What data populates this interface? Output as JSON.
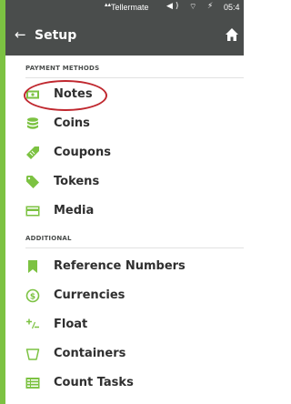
{
  "status_bar": {
    "carrier": "Tellermate",
    "time": "05:4"
  },
  "toolbar": {
    "title": "Setup"
  },
  "sections": {
    "payment_methods": "PAYMENT METHODS",
    "additional": "ADDITIONAL"
  },
  "payment_items": [
    {
      "label": "Notes",
      "icon": "banknote-icon"
    },
    {
      "label": "Coins",
      "icon": "coin-stack-icon"
    },
    {
      "label": "Coupons",
      "icon": "coupon-icon"
    },
    {
      "label": "Tokens",
      "icon": "tag-icon"
    },
    {
      "label": "Media",
      "icon": "card-icon"
    }
  ],
  "additional_items": [
    {
      "label": "Reference Numbers",
      "icon": "bookmark-icon"
    },
    {
      "label": "Currencies",
      "icon": "dollar-circle-icon"
    },
    {
      "label": "Float",
      "icon": "plus-minus-icon"
    },
    {
      "label": "Containers",
      "icon": "container-icon"
    },
    {
      "label": "Count Tasks",
      "icon": "tasks-icon"
    }
  ],
  "colors": {
    "accent": "#7cc242",
    "toolbar": "#4a4d4c",
    "highlight": "#c0282f"
  }
}
